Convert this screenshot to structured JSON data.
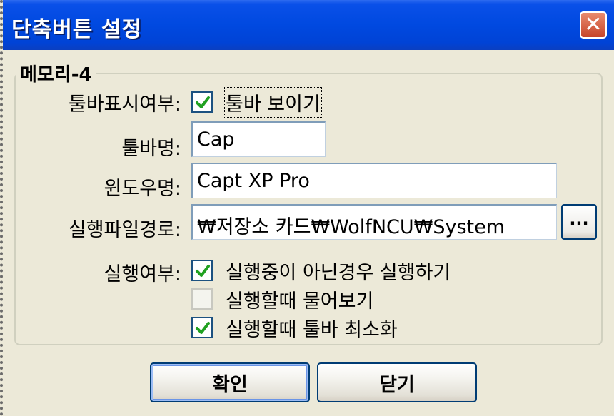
{
  "window": {
    "title": "단축버튼 설정",
    "close_symbol": "✕"
  },
  "group": {
    "title": "메모리-4"
  },
  "form": {
    "toolbar_display_label": "툴바표시여부:",
    "show_toolbar": {
      "label": "툴바 보이기",
      "checked": true
    },
    "toolbar_name_label": "툴바명:",
    "toolbar_name_value": "Cap",
    "window_name_label": "윈도우명:",
    "window_name_value": "Capt XP Pro",
    "exec_path_label": "실행파일경로:",
    "exec_path_value": "₩저장소 카드₩WolfNCU₩System",
    "browse_label": "...",
    "run_label": "실행여부:",
    "run_options": [
      {
        "label": "실행중이 아닌경우 실행하기",
        "checked": true,
        "enabled": true
      },
      {
        "label": "실행할때 물어보기",
        "checked": false,
        "enabled": false
      },
      {
        "label": "실행할때 툴바 최소화",
        "checked": true,
        "enabled": true
      }
    ]
  },
  "buttons": {
    "ok": "확인",
    "close": "닫기"
  },
  "colors": {
    "title_bar": "#0049e0",
    "dialog_bg": "#ece9d8",
    "check_green": "#21a121",
    "close_red": "#c7452a"
  },
  "icons": {
    "close": "close-icon",
    "check": "checkmark-icon"
  }
}
